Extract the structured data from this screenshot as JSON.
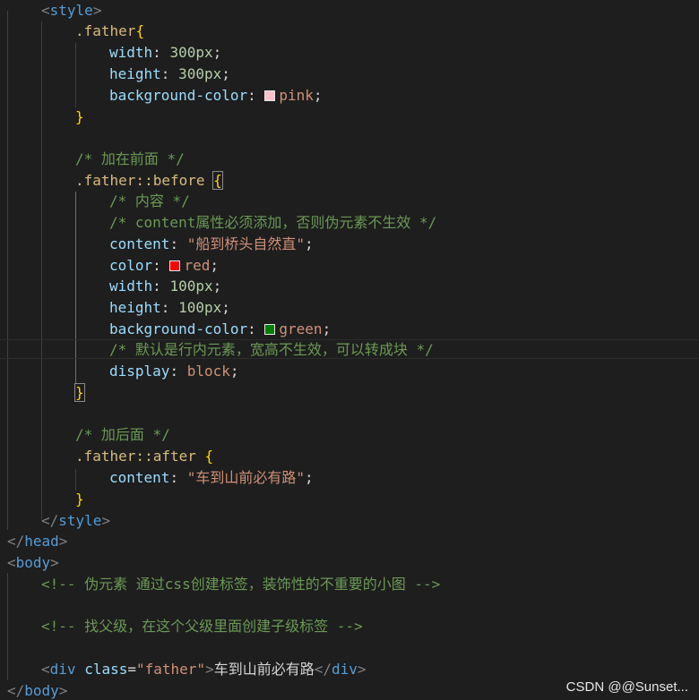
{
  "colors": {
    "pink": "#ffc0cb",
    "red": "#ff0000",
    "green": "#008000"
  },
  "code": {
    "style_open": "style",
    "father_selector": ".father",
    "width_prop": "width",
    "width_val": "300px",
    "height_prop": "height",
    "height_val": "300px",
    "bg_prop": "background-color",
    "bg_val_pink": "pink",
    "comment_before": "/* 加在前面 */",
    "before_selector": ".father::before",
    "comment_content": "/* 内容 */",
    "comment_required": "/* content属性必须添加，否则伪元素不生效 */",
    "content_prop": "content",
    "content_before_val": "\"船到桥头自然直\"",
    "color_prop": "color",
    "color_val": "red",
    "before_width_val": "100px",
    "before_height_val": "100px",
    "bg_val_green": "green",
    "comment_inline": "/* 默认是行内元素，宽高不生效，可以转成块 */",
    "display_prop": "display",
    "display_val": "block",
    "comment_after": "/* 加后面 */",
    "after_selector": ".father::after",
    "content_after_val": "\"车到山前必有路\"",
    "style_close": "style",
    "head_close": "head",
    "body_open": "body",
    "html_comment_1": "<!-- 伪元素 通过css创建标签，装饰性的不重要的小图 -->",
    "html_comment_2": "<!-- 找父级，在这个父级里面创建子级标签 -->",
    "div_tag": "div",
    "class_attr": "class",
    "class_val": "\"father\"",
    "div_text": "车到山前必有路",
    "body_close": "body"
  },
  "watermark": "CSDN @@Sunset..."
}
